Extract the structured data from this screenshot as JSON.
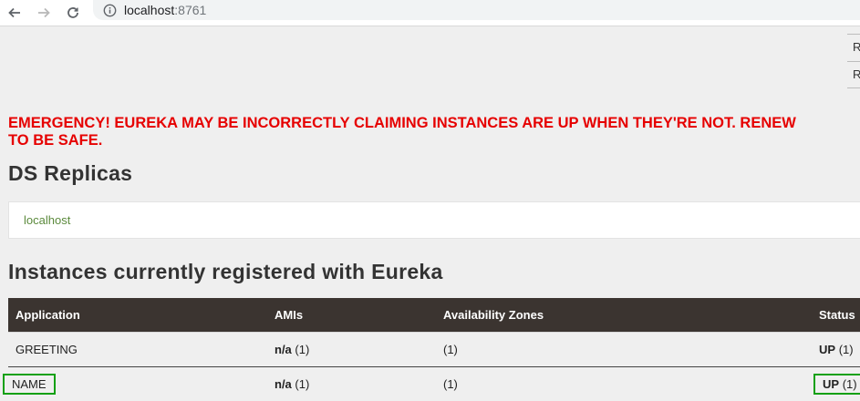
{
  "browser": {
    "url_host": "localhost",
    "url_port": ":8761"
  },
  "nav_fragments": [
    "R",
    "R"
  ],
  "emergency": {
    "line1": "EMERGENCY! EUREKA MAY BE INCORRECTLY CLAIMING INSTANCES ARE UP WHEN THEY'RE NOT. RENEW",
    "line2": "TO BE SAFE."
  },
  "ds_replicas": {
    "heading": "DS Replicas",
    "items": [
      "localhost"
    ]
  },
  "instances": {
    "heading": "Instances currently registered with Eureka",
    "columns": [
      "Application",
      "AMIs",
      "Availability Zones",
      "Status"
    ],
    "rows": [
      {
        "application": "GREETING",
        "amis_value": "n/a",
        "amis_count": "(1)",
        "zones": "(1)",
        "status": "UP",
        "status_count": "(1)"
      },
      {
        "application": "NAME",
        "amis_value": "n/a",
        "amis_count": "(1)",
        "zones": "(1)",
        "status": "UP",
        "status_count": "(1)"
      }
    ]
  },
  "colors": {
    "emergency": "#e60000",
    "header_bg": "#3b3430",
    "link": "#5b8a3c",
    "highlight": "#11a011"
  }
}
